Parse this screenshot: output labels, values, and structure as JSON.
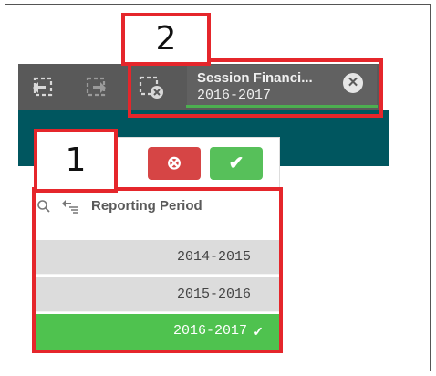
{
  "toolbar": {
    "icons": [
      "step-back-icon",
      "step-forward-icon",
      "clear-selections-icon"
    ],
    "session": {
      "title": "Session Financi...",
      "value": "2016-2017",
      "close_icon": "close-circle-icon"
    }
  },
  "callouts": {
    "one": "1",
    "two": "2"
  },
  "selection_panel": {
    "cancel_icon": "x-circle-icon",
    "confirm_icon": "check-icon",
    "search_icon": "search-icon",
    "filter_icon": "filter-list-icon",
    "field_title": "Reporting Period",
    "items": [
      {
        "label": "2014-2015",
        "state": "excluded"
      },
      {
        "label": "2015-2016",
        "state": "excluded"
      },
      {
        "label": "2016-2017",
        "state": "selected"
      }
    ]
  },
  "colors": {
    "toolbar_bg": "#595959",
    "teal_bg": "#00565f",
    "callout_red": "#e5262b",
    "selected_green": "#4fc24f",
    "excluded_gray": "#dcdcdc",
    "cancel_red": "#d64545",
    "confirm_green": "#57c05a"
  }
}
